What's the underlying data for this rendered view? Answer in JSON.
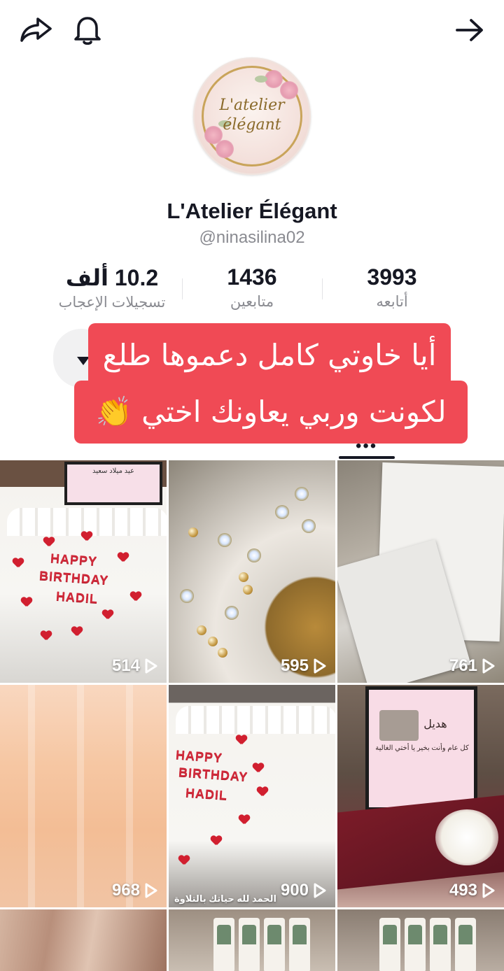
{
  "profile": {
    "name": "L'Atelier Élégant",
    "handle": "@ninasilina02",
    "logo_line1": "L'atelier",
    "logo_line2": "élégant"
  },
  "stats": {
    "likes": {
      "value": "10.2 ألف",
      "label": "تسجيلات الإعجاب"
    },
    "followers": {
      "value": "1436",
      "label": "متابعين"
    },
    "following": {
      "value": "3993",
      "label": "أتابعه"
    }
  },
  "overlay": {
    "line1": "أيا خاوتي كامل دعموها طلع",
    "line2": "لكونت وربي يعاونك اختي 👏"
  },
  "videos": [
    {
      "views": "514",
      "kind": "cake"
    },
    {
      "views": "595",
      "kind": "gold-tray"
    },
    {
      "views": "761",
      "kind": "white-cards"
    },
    {
      "views": "968",
      "kind": "peach"
    },
    {
      "views": "900",
      "kind": "cake"
    },
    {
      "views": "493",
      "kind": "frame-gift"
    }
  ],
  "tile_texts": {
    "cake1_frame": "عيد ميلاد سعيد",
    "cake_l1": "HAPPY",
    "cake_l2": "BIRTHDAY",
    "cake_l3": "HADIL",
    "frame_title": "هديل",
    "frame_text": "كل عام وأنت بخير يا أختي الغالية",
    "tile5_caption": "الحمد لله حياتك بالتلاوة"
  },
  "colors": {
    "overlay_bg": "#f04a55",
    "text_primary": "#161823",
    "text_secondary": "#8a8b91"
  },
  "icons": [
    "share-icon",
    "bell-icon",
    "back-arrow-icon",
    "dropdown-caret-icon",
    "play-icon"
  ]
}
